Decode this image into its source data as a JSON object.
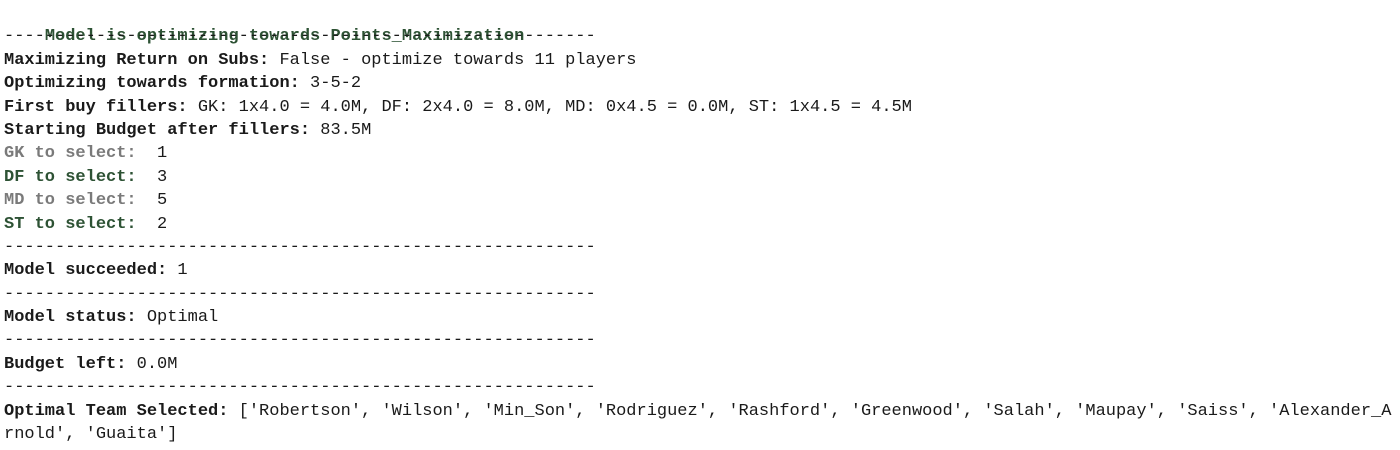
{
  "output": {
    "header": "Model is optimizing towards Points_Maximization",
    "separator": "----------------------------------------------------------",
    "maximizing_label": "Maximizing Return on Subs:",
    "maximizing_value": " False - optimize towards 11 players",
    "formation_label": "Optimizing towards formation:",
    "formation_value": " 3-5-2",
    "fillers_label": "First buy fillers:",
    "fillers_value": " GK: 1x4.0 = 4.0M, DF: 2x4.0 = 8.0M, MD: 0x4.5 = 0.0M, ST: 1x4.5 = 4.5M",
    "budget_label": "Starting Budget after fillers:",
    "budget_value": " 83.5M",
    "positions": [
      {
        "label": "GK to select:",
        "value": "  1"
      },
      {
        "label": "DF to select:",
        "value": "  3"
      },
      {
        "label": "MD to select:",
        "value": "  5"
      },
      {
        "label": "ST to select:",
        "value": "  2"
      }
    ],
    "succeeded_label": "Model succeeded:",
    "succeeded_value": " 1",
    "status_label": "Model status:",
    "status_value": " Optimal",
    "budget_left_label": "Budget left:",
    "budget_left_value": " 0.0M",
    "team_label": "Optimal Team Selected:",
    "team_value": " ['Robertson', 'Wilson', 'Min_Son', 'Rodriguez', 'Rashford', 'Greenwood', 'Salah', 'Maupay', 'Saiss', 'Alexander_Arnold', 'Guaita']"
  },
  "colors": {
    "label_green": "#2d5234",
    "label_gray": "#7a7a7a",
    "text": "#1a1a1a"
  }
}
